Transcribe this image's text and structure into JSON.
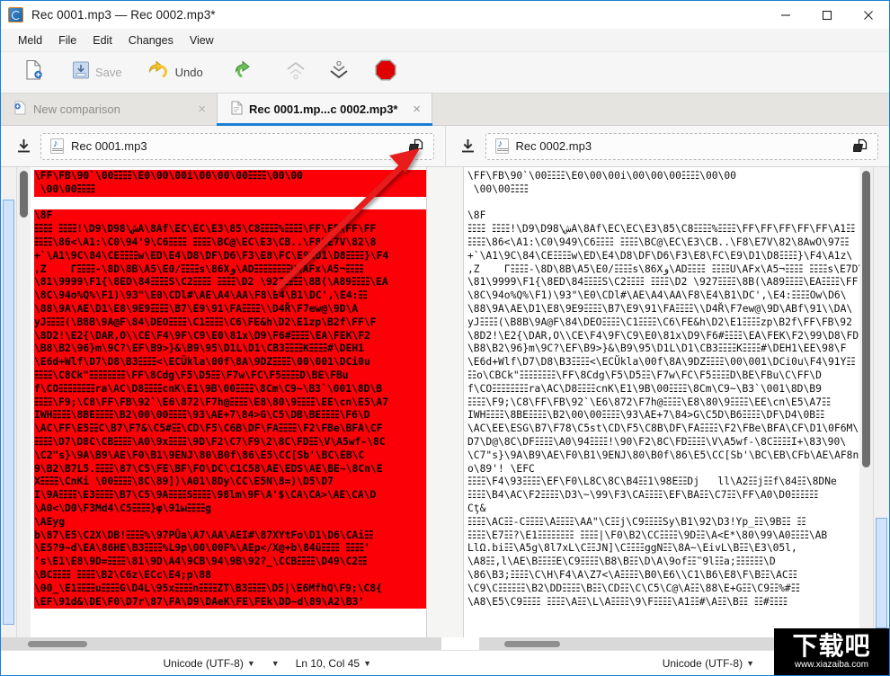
{
  "window": {
    "title": "Rec 0001.mp3 — Rec 0002.mp3*",
    "app_icon": "meld-app-icon",
    "minimize_label": "—",
    "maximize_label": "□",
    "close_label": "✕"
  },
  "menubar": {
    "items": [
      {
        "label": "Meld"
      },
      {
        "label": "File"
      },
      {
        "label": "Edit"
      },
      {
        "label": "Changes"
      },
      {
        "label": "View"
      }
    ]
  },
  "toolbar": {
    "new_label": "",
    "new_icon": "new-document-icon",
    "save_label": "Save",
    "save_icon": "save-icon",
    "undo_label": "Undo",
    "undo_icon": "undo-arrow-icon",
    "redo_icon": "redo-arrow-icon",
    "prev_change_icon": "chevron-up-change-icon",
    "next_change_icon": "chevron-down-change-icon",
    "stop_icon": "stop-octagon-icon"
  },
  "tabs": [
    {
      "label": "New comparison",
      "icon": "new-comparison-icon",
      "close": "×",
      "active": false
    },
    {
      "label": "Rec 0001.mp...c 0002.mp3*",
      "icon": "document-icon",
      "close": "×",
      "active": true
    }
  ],
  "choosers": {
    "left": {
      "download_icon": "download-icon",
      "file_icon": "mp3-file-icon",
      "file_name": "Rec 0001.mp3",
      "open_icon": "open-folder-icon"
    },
    "right": {
      "download_icon": "download-icon",
      "file_icon": "mp3-file-icon",
      "file_name": "Rec 0002.mp3",
      "open_icon": "open-folder-icon"
    }
  },
  "colors": {
    "accent": "#1a7fd4",
    "diff_highlight": "#fb0007",
    "overview_selection": "#cfe4fb",
    "arrow": "#e81b1b"
  },
  "panes": {
    "left": {
      "lines": [
        {
          "text": "\\FF\\FB\\90`\\00☷☷\\E0\\00\\00i\\00\\00\\00☷☷\\00\\00",
          "diff": true
        },
        {
          "text": " \\00\\00☷☷",
          "diff": true
        },
        {
          "text": "",
          "diff": false
        },
        {
          "text": "\\8F",
          "diff": true
        },
        {
          "text": "☷☷ ☷☷!\\D9\\D98\\شA\\8Af\\EC\\EC\\E3\\85\\C8☷☷%☷☷\\FF\\FF\\FF\\FF",
          "diff": true
        },
        {
          "text": "☷☷\\86<\\A1:\\C0\\94'9\\C6☷☷ ☷☷\\BC@\\EC\\E3\\CB..\\F8\\E7V\\82\\8",
          "diff": true
        },
        {
          "text": "+`\\A1\\9C\\84\\CE☷☷w\\ED\\E4\\D8\\DF\\D6\\F3\\E8\\FC\\E9\\D1\\D8☷☷}\\F4",
          "diff": true
        },
        {
          "text": ",Z    Г☷☷-\\8D\\8B\\A5\\E0/☷☷s\\86Xو\\AD☷☷☷☷U\\AFx\\A5¬☷☷",
          "diff": true
        },
        {
          "text": "\\81\\9999\\F1{\\8ED\\84☷☷S\\C2☷☷ ☷☷\\D2 \\927☷☷\\8B(\\A89☷☷\\EA",
          "diff": true
        },
        {
          "text": "\\8C\\94o%Q%\\F1)\\93\"\\E0\\CDl#\\AE\\A4\\AA\\F8\\E4\\B1\\DC',\\E4:☷",
          "diff": true
        },
        {
          "text": "\\88\\9A\\AE\\D1\\E8\\9E9☷☷\\B7\\E9\\91\\FA☷☷\\\\D4Ř\\F7ew@\\9D\\A",
          "diff": true
        },
        {
          "text": "yJ☷☷(\\B8B\\9A@F\\84\\DEO☷☷\\C1☷☷\\C6\\FE&h\\D2\\E1zp\\B2f\\FF\\F",
          "diff": true
        },
        {
          "text": "\\8D2!\\E2{\\DAR,O\\\\CE\\F4\\9F\\C9\\E0\\81x\\D9\\F6#☷☷\\EA\\FEK\\F2",
          "diff": true
        },
        {
          "text": "\\B8\\B2\\96}m\\9C?\\EF\\B9>}&\\B9\\95\\D1L\\D1\\CB3☷☷K☷☷#\\DEH1",
          "diff": true
        },
        {
          "text": "\\E6d+Wlf\\D7\\D8\\B3☷☷<\\ECŬkla\\00f\\8A\\9DZ☷☷\\00\\001\\DCi0u",
          "diff": true
        },
        {
          "text": "☷☷\\C8Ck\"☷☷☷☷\\FF\\8Cdg\\F5\\D5☷\\F7w\\FC\\F5☷☷D\\BE\\FBu",
          "diff": true
        },
        {
          "text": "f\\CO☷☷☷☷ra\\AC\\D8☷☷cnK\\E1\\9B\\00☷☷\\8Cm\\C9~\\B3`\\001\\8D\\B",
          "diff": true
        },
        {
          "text": "☷☷\\F9;\\C8\\FF\\FB\\92`\\E6\\872\\F7h@☷☷\\E8\\80\\9☷☷\\EE\\cn\\E5\\A7",
          "diff": true
        },
        {
          "text": "IWH☷☷\\8BE☷☷\\B2\\00\\00☷☷\\93\\AE+7\\84>G\\C5\\DB\\BE☷☷\\F6\\D",
          "diff": true
        },
        {
          "text": "\\AC\\FF\\E5☷C\\B7\\F7&\\C5#☷\\CD\\F5\\C6B\\DF\\FA☷☷\\F2\\FBe\\BFA\\CF",
          "diff": true
        },
        {
          "text": "☷☷\\D7\\D8C\\CB☷☷\\A0\\9x☷☷\\9D\\F2\\C7\\F9\\2\\8C\\FD☷\\V\\A5wf-\\8C",
          "diff": true
        },
        {
          "text": "\\C2\"s}\\9A\\B9\\AE\\F0\\B1\\9ENJ\\80\\B0f\\86\\E5\\CC[Sb'\\BC\\EB\\C",
          "diff": true
        },
        {
          "text": "9\\B2\\B7L5.☷☷\\87\\C5\\FE\\BF\\FO\\DC\\C1C58\\AE\\EDS\\AE\\BE~\\8Cn\\E",
          "diff": true
        },
        {
          "text": "X☷☷\\CnKi \\00☷☷\\8C\\89])\\A01\\8Dy\\CC\\E5N\\8=)\\D5\\D7",
          "diff": true
        },
        {
          "text": "I\\9A☷☷\\E3☷☷\\B7\\C5\\9A☷☷S☷☷\\98lm\\9F\\A'$\\CA\\CA>\\AE\\CA\\D",
          "diff": true
        },
        {
          "text": "\\A0<\\D0\\F3Md4\\C5☷☷}φ\\91ы☷☷g",
          "diff": true
        },
        {
          "text": "\\AEyg",
          "diff": true
        },
        {
          "text": "b\\87\\E5\\C2X\\DB!☷☷%\\97PŪa\\A7\\AA\\AEI#\\87XYtFo\\D1\\D6\\CAi☷",
          "diff": true
        },
        {
          "text": "\\E5?9~d\\EA\\86HE\\B3☷☷%L9p\\00\\00F%\\AEp</X@+b\\84ü☷☷ ☷☷'",
          "diff": true
        },
        {
          "text": "'s\\E1\\E8\\9D=☷☷\\81\\9D\\A4\\9CB\\94\\9B\\92?_\\CCB☷☷\\D49\\C2☷",
          "diff": true
        },
        {
          "text": "\\BC☷☷ ☷☷\\B2\\C6z\\ECc\\E4;p\\88",
          "diff": true
        },
        {
          "text": "\\00_\\E1☷☷u☷☷G\\D4L\\95x☷☷n☷☷ZT\\B3☷☷\\D5|\\E6MfhQ\\F9;\\C8{",
          "diff": true
        },
        {
          "text": "\\EF\\91d&\\DE\\F0\\D7r\\87\\FA\\D9\\DAeK\\FE\\FEk\\DD~d\\89\\A2\\B3'",
          "diff": true
        }
      ]
    },
    "right": {
      "lines": [
        {
          "text": "\\FF\\FB\\90`\\00☷☷\\E0\\00\\00i\\00\\00\\00☷☷\\00\\00"
        },
        {
          "text": " \\00\\00☷☷"
        },
        {
          "text": ""
        },
        {
          "text": "\\8F"
        },
        {
          "text": "☷☷ ☷☷!\\D9\\D98\\شA\\8Af\\EC\\EC\\E3\\85\\C8☷☷%☷☷\\FF\\FF\\FF\\FF\\FF\\A1☷"
        },
        {
          "text": "☷☷\\86<\\A1:\\C0\\949\\C6☷☷ ☷☷\\BC@\\EC\\E3\\CB..\\F8\\E7V\\82\\8AwO\\97☷"
        },
        {
          "text": "+`\\A1\\9C\\84\\CE☷☷w\\ED\\E4\\D8\\DF\\D6\\F3\\E8\\FC\\E9\\D1\\D8☷☷}\\F4\\A1z\\"
        },
        {
          "text": ",Z    Г☷☷-\\8D\\8B\\A5\\E0/☷☷s\\86Xو\\AD☷☷ ☷☷U\\AFx\\A5¬☷☷ ☷☷s\\E7D\\"
        },
        {
          "text": "\\81\\9999\\F1{\\8ED\\84☷☷S\\C2☷☷ ☷☷\\D2 \\927☷☷\\8B(\\A89☷☷\\EA☷☷\\FF[["
        },
        {
          "text": "\\8C\\94o%Q%\\F1)\\93\"\\E0\\CDl#\\AE\\A4\\AA\\F8\\E4\\B1\\DC',\\E4:☷☷Ow\\D6\\"
        },
        {
          "text": "\\88\\9A\\AE\\D1\\E8\\9E9☷☷\\B7\\E9\\91\\FA☷☷\\\\D4Ř\\F7ew@\\9D\\ABf\\91\\\\DA\\"
        },
        {
          "text": "yJ☷☷(\\B8B\\9A@F\\84\\DEO☷☷\\C1☷☷\\C6\\FE&h\\D2\\E1☷☷zp\\B2f\\FF\\FB\\92"
        },
        {
          "text": "\\8D2!\\E2{\\DAR,O\\\\CE\\F4\\9F\\C9\\E0\\81x\\D9\\F6#☷☷\\EA\\FEK\\F2\\99\\D8\\FD"
        },
        {
          "text": "\\B8\\B2\\96}m\\9C?\\EF\\B9>}&\\B9\\95\\D1L\\D1\\CB3☷☷K☷☷#\\DEH1\\EE\\98\\F"
        },
        {
          "text": "\\E6d+Wlf\\D7\\D8\\B3☷☷<\\ECŬkla\\00f\\8A\\9DZ☷☷\\00\\001\\DCi0u\\F4\\91Y☷"
        },
        {
          "text": "☷o\\CBCk\"☷☷☷☷\\FF\\8Cdg\\F5\\D5☷\\F7w\\FC\\F5☷☷D\\BE\\FBu\\C\\FF\\D"
        },
        {
          "text": "f\\CO☷☷☷☷ra\\AC\\D8☷☷cnK\\E1\\9B\\00☷☷\\8Cm\\C9~\\B3`\\001\\8D\\B9"
        },
        {
          "text": "☷☷\\F9;\\C8\\FF\\FB\\92`\\E6\\872\\F7h@☷☷\\E8\\80\\9☷☷\\EE\\cn\\E5\\A7☷"
        },
        {
          "text": "IWH☷☷\\8BE☷☷\\B2\\00\\00☷☷\\93\\AE+7\\84>G\\C5D\\B6☷☷\\DF\\D4\\0B☷"
        },
        {
          "text": "\\AC\\EE\\ESG\\B7\\F78\\C5st\\CD\\F5\\C8B\\DF\\FA☷☷\\F2\\FBe\\BFA\\CF\\D1\\0F6M\\"
        },
        {
          "text": "D7\\D@\\8C\\DF☷☷\\A0\\94☷☷!\\90\\F2\\8C\\FD☷☷\\V\\A5wf-\\8C☷☷I+\\83\\90\\"
        },
        {
          "text": "\\C7\"s}\\9A\\B9\\AE\\F0\\B1\\9ENJ\\80\\B0f\\86\\E5\\CC[Sb'\\BC\\EB\\CFb\\AE\\AF8n"
        },
        {
          "text": "o\\89'! \\EFC"
        },
        {
          "text": "☷☷\\F4\\93☷☷\\EF\\F0\\L8C\\8C\\B4☷1\\98E☷Dj   ll\\A2☷j☷f\\84☷\\8DNe"
        },
        {
          "text": "☷☷\\B4\\AC\\F2☷☷\\D3\\~\\99\\F3\\CA☷☷\\EF\\BA☷\\C7☷\\FF\\A0\\D0☷☷☷"
        },
        {
          "text": "Cţ&"
        },
        {
          "text": "☷☷\\AC☷-C☷☷\\A☷☷\\AA\"\\C☷j\\C9☷☷Sy\\B1\\92\\D3!Yp_☷\\9B☷ ☷"
        },
        {
          "text": "☷☷\\E7☷?\\E1☷☷☷☷ ☷☷|\\F0\\B2\\CC☷☷\\9D☷\\A<E*\\80\\99\\A0☷☷\\AB"
        },
        {
          "text": "LlΩ.bi☷\\A5g\\8l7xL\\C☷JN]\\C☷☷ggN☷\\8A~\\EivL\\B☷\\E3\\05l,"
        },
        {
          "text": "\\A8☷,l\\AE\\B☷☷E\\C9☷☷\\B8\\B☷\\D\\A\\9of☷‷9l☷a;☷☷☷\\D"
        },
        {
          "text": "\\86\\B3;☷☷\\C\\H\\F4\\A\\Z7<\\A☷☷\\B0\\E6\\\\C1\\B6\\E8\\F\\B☷\\AC☷"
        },
        {
          "text": "\\C9\\C☷☷☷\\B2\\DD☷☷\\B☷\\CD☷\\C\\C5\\C@\\A☷\\88\\E+G☷\\C9☷%#☷"
        },
        {
          "text": "\\A8\\E5\\C9☷☷ ☷☷\\A☷\\L\\A☷☷\\9\\F☷☷\\A1☷#\\A☷\\B☷ ☷#☷☷"
        }
      ]
    }
  },
  "scrollbars": {
    "left_vertical_thumb": "left-scroll-thumb",
    "right_vertical_thumb": "right-scroll-thumb",
    "left_horizontal_thumb": "left-hscroll-thumb",
    "right_horizontal_thumb": "right-hscroll-thumb"
  },
  "statusbar": {
    "left": {
      "encoding": "Unicode (UTF-8)",
      "encoding_caret": "▼",
      "line_ending_caret": "▼",
      "cursor_position": "Ln 10, Col 45",
      "cursor_caret": "▼"
    },
    "right": {
      "encoding": "Unicode (UTF-8)",
      "encoding_caret": "▼"
    }
  },
  "annotation": {
    "arrow_name": "red-pointer-arrow",
    "points_to": "open-folder-icon"
  },
  "watermark": {
    "text_cn": "下载吧",
    "url": "www.xiazaiba.com"
  }
}
